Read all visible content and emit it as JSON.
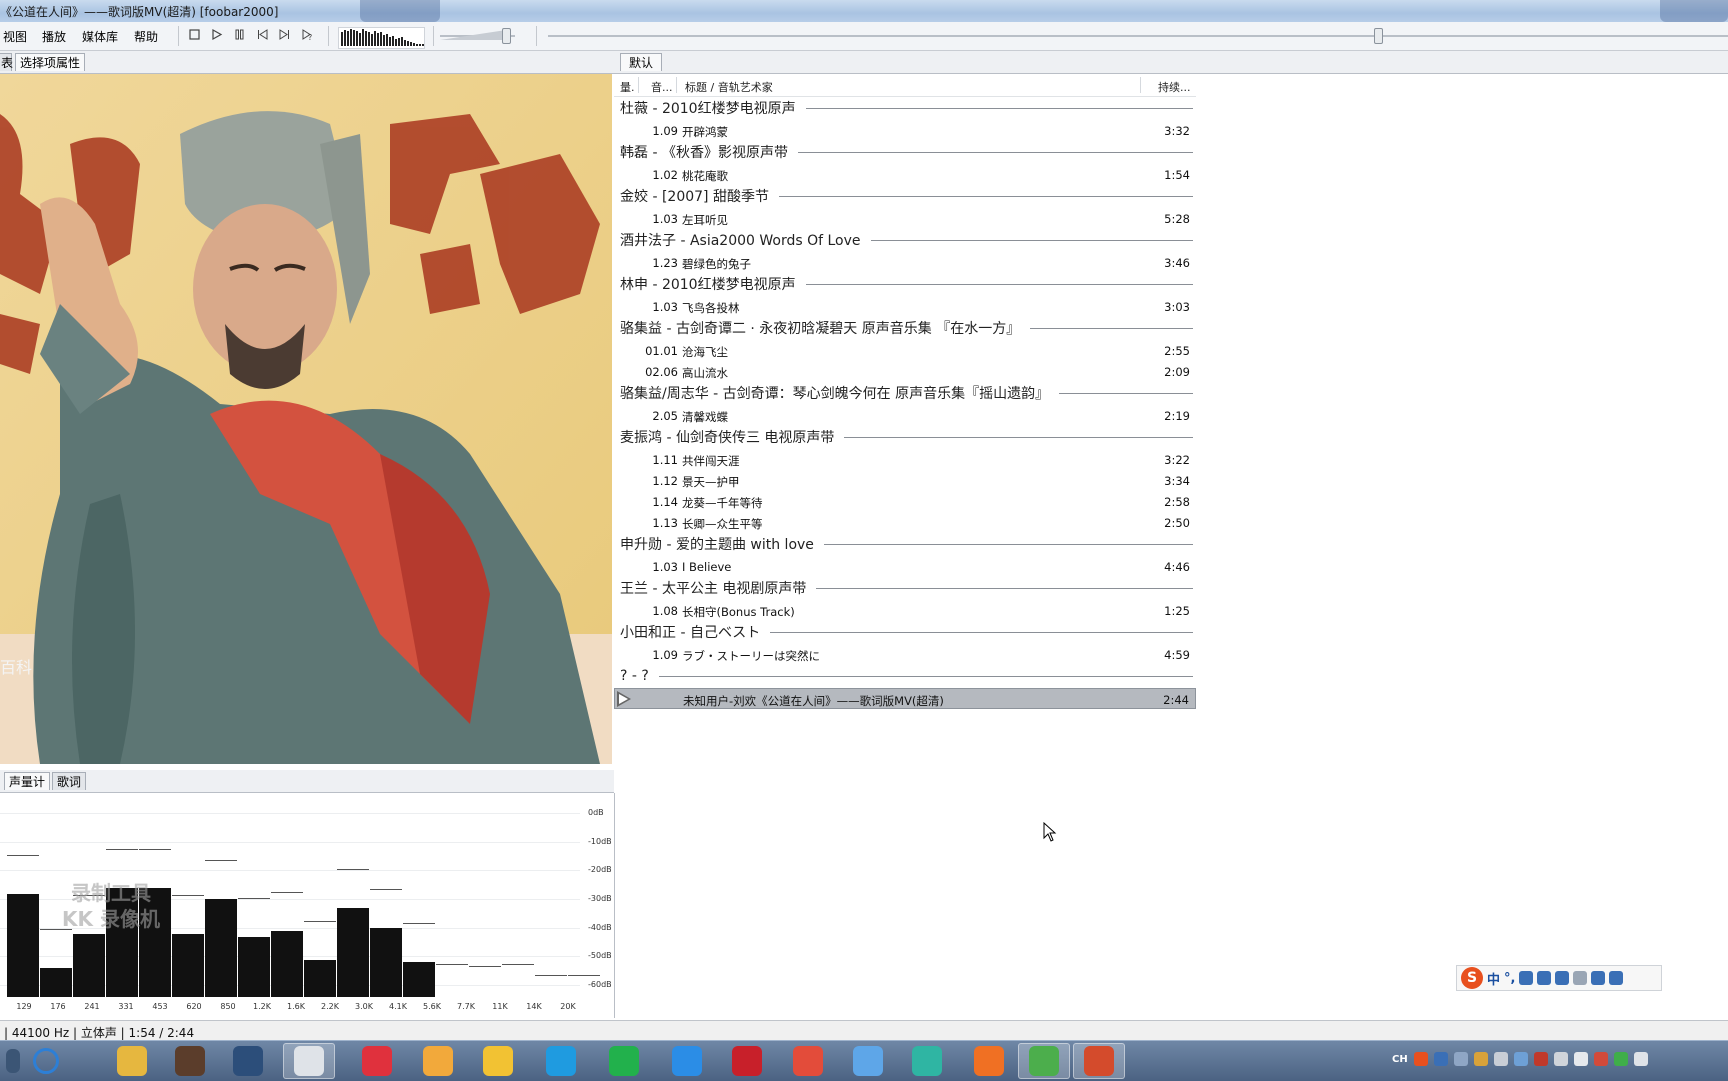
{
  "window": {
    "title": "《公道在人间》——歌词版MV(超清)  [foobar2000]"
  },
  "menu": {
    "items": [
      "视图",
      "播放",
      "媒体库",
      "帮助"
    ]
  },
  "toolbar": {
    "buttons": [
      "stop-icon",
      "play-icon",
      "pause-icon",
      "previous-icon",
      "next-icon",
      "random-icon"
    ],
    "volume_level": 0.88,
    "seek_position": 0.7
  },
  "left_panel": {
    "tabs": [
      "表",
      "选择项属性"
    ],
    "video_caption": "百科",
    "bottom_tabs": [
      "声量计",
      "歌词"
    ]
  },
  "spectrum": {
    "db_labels": [
      "0dB",
      "-10dB",
      "-20dB",
      "-30dB",
      "-40dB",
      "-50dB",
      "-60dB"
    ],
    "freq_labels": [
      "129",
      "176",
      "241",
      "331",
      "453",
      "620",
      "850",
      "1.2K",
      "1.6K",
      "2.2K",
      "3.0K",
      "4.1K",
      "5.6K",
      "7.7K",
      "11K",
      "14K",
      "20K"
    ],
    "bar_levels_db": [
      -18,
      -44,
      -32,
      -16,
      -16,
      -32,
      -20,
      -33,
      -31,
      -41,
      -23,
      -30,
      -42,
      -56,
      -57,
      -56,
      -60,
      -60
    ],
    "watermark_line1": "录制工具",
    "watermark_line2": "KK 录像机"
  },
  "playlist": {
    "tab": "默认",
    "columns": {
      "col1": "量.",
      "col2": "音...",
      "col3": "标题 / 音轨艺术家",
      "col4": "持续..."
    },
    "groups": [
      {
        "header": "杜薇 - 2010红楼梦电视原声",
        "tracks": [
          {
            "no": "1.09",
            "title": "开辟鸿蒙",
            "dur": "3:32"
          }
        ]
      },
      {
        "header": "韩磊 - 《秋香》影视原声带",
        "tracks": [
          {
            "no": "1.02",
            "title": "桃花庵歌",
            "dur": "1:54"
          }
        ]
      },
      {
        "header": "金姣 - [2007] 甜酸季节",
        "tracks": [
          {
            "no": "1.03",
            "title": "左耳听见",
            "dur": "5:28"
          }
        ]
      },
      {
        "header": "酒井法子 - Asia2000 Words Of Love",
        "tracks": [
          {
            "no": "1.23",
            "title": "碧绿色的兔子",
            "dur": "3:46"
          }
        ]
      },
      {
        "header": "林申 - 2010红楼梦电视原声",
        "tracks": [
          {
            "no": "1.03",
            "title": "飞鸟各投林",
            "dur": "3:03"
          }
        ]
      },
      {
        "header": "骆集益 - 古剑奇谭二 · 永夜初晗凝碧天 原声音乐集 『在水一方』",
        "tracks": [
          {
            "no": "01.01",
            "title": "沧海飞尘",
            "dur": "2:55"
          },
          {
            "no": "02.06",
            "title": "高山流水",
            "dur": "2:09"
          }
        ]
      },
      {
        "header": "骆集益/周志华 - 古剑奇谭：琴心剑魄今何在 原声音乐集『摇山遗韵』",
        "tracks": [
          {
            "no": "2.05",
            "title": "清馨戏蝶",
            "dur": "2:19"
          }
        ]
      },
      {
        "header": "麦振鸿 - 仙剑奇侠传三 电视原声带",
        "tracks": [
          {
            "no": "1.11",
            "title": "共伴闯天涯",
            "dur": "3:22"
          },
          {
            "no": "1.12",
            "title": "景天—护甲",
            "dur": "3:34"
          },
          {
            "no": "1.14",
            "title": "龙葵—千年等待",
            "dur": "2:58"
          },
          {
            "no": "1.13",
            "title": "长卿—众生平等",
            "dur": "2:50"
          }
        ]
      },
      {
        "header": "申升勋 - 爱的主题曲 with love",
        "tracks": [
          {
            "no": "1.03",
            "title": "I Believe",
            "dur": "4:46"
          }
        ]
      },
      {
        "header": "王兰 - 太平公主 电视剧原声带",
        "tracks": [
          {
            "no": "1.08",
            "title": "长相守(Bonus Track)",
            "dur": "1:25"
          }
        ]
      },
      {
        "header": "小田和正 - 自己ベスト",
        "tracks": [
          {
            "no": "1.09",
            "title": "ラブ・ストーリーは突然に",
            "dur": "4:59"
          }
        ]
      },
      {
        "header": "? - ?",
        "tracks": [
          {
            "no": "",
            "title": "未知用户-刘欢《公道在人间》——歌词版MV(超清)",
            "dur": "2:44",
            "playing": true
          }
        ]
      }
    ]
  },
  "status": {
    "text": "| 44100 Hz | 立体声 | 1:54 / 2:44"
  },
  "ime": {
    "logo": "S",
    "mode": "中",
    "punct": "°,"
  },
  "taskbar": {
    "apps": [
      "start-orb",
      "search-icon",
      "file-explorer-icon",
      "video-editor-icon",
      "headphones-icon",
      "foobar-alien-icon",
      "netease-music-icon",
      "media-player-icon",
      "potplayer-icon",
      "number-one-icon",
      "iqiyi-icon",
      "youku-icon",
      "flash-icon",
      "chrome-icon",
      "paper-plane-icon",
      "play-store-icon",
      "firefox-icon",
      "green-browser-icon",
      "ninja-icon"
    ],
    "tray_text": "CH"
  }
}
